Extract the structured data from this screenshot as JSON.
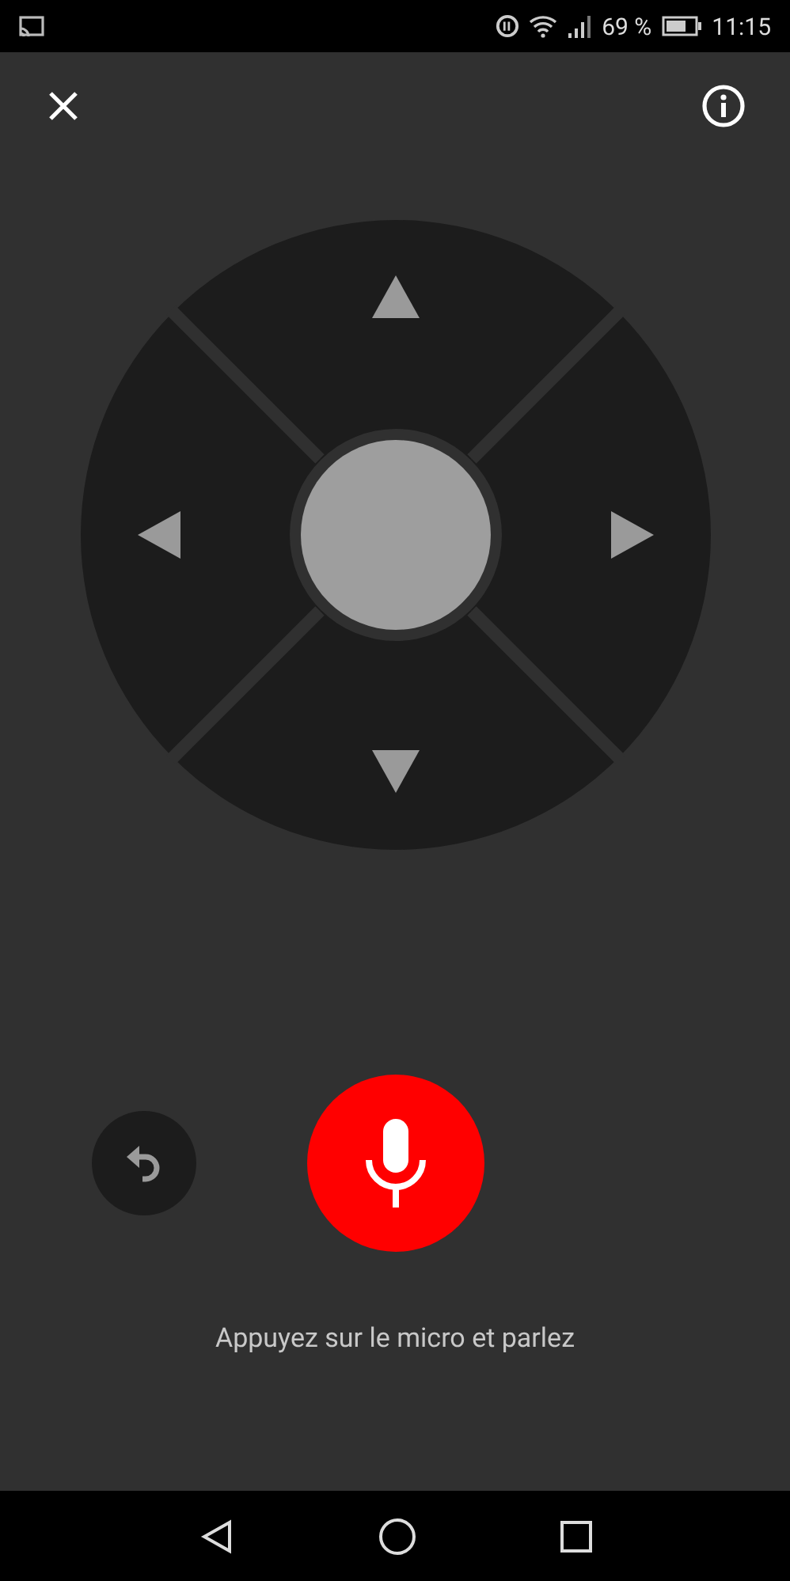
{
  "status_bar": {
    "battery": "69 %",
    "time": "11:15"
  },
  "hint": "Appuyez sur le micro et parlez"
}
